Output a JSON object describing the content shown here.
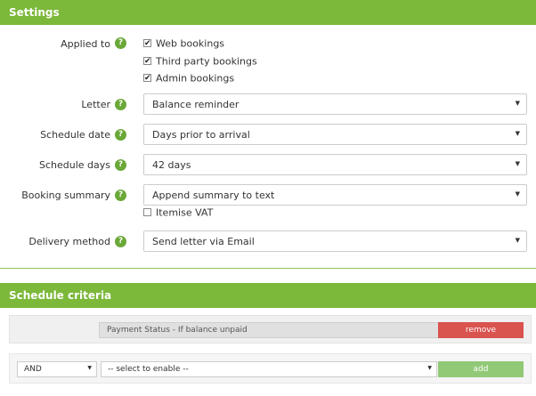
{
  "settings": {
    "title": "Settings",
    "applied_to": {
      "label": "Applied to",
      "options": [
        {
          "label": "Web bookings",
          "checked": true
        },
        {
          "label": "Third party bookings",
          "checked": true
        },
        {
          "label": "Admin bookings",
          "checked": true
        }
      ]
    },
    "letter": {
      "label": "Letter",
      "value": "Balance reminder"
    },
    "schedule_date": {
      "label": "Schedule date",
      "value": "Days prior to arrival"
    },
    "schedule_days": {
      "label": "Schedule days",
      "value": "42 days"
    },
    "booking_summary": {
      "label": "Booking summary",
      "value": "Append summary to text",
      "itemise_vat": {
        "label": "Itemise VAT",
        "checked": false
      }
    },
    "delivery_method": {
      "label": "Delivery method",
      "value": "Send letter via Email"
    }
  },
  "schedule_criteria": {
    "title": "Schedule criteria",
    "criteria": [
      {
        "text": "Payment Status - If balance unpaid",
        "remove_label": "remove"
      }
    ],
    "new_row": {
      "operator": "AND",
      "field_placeholder": "-- select to enable --",
      "add_label": "add"
    }
  },
  "icons": {
    "help": "help-question-icon",
    "check": "checkmark-icon",
    "dropdown": "dropdown-arrow-icon"
  },
  "colors": {
    "header_green": "#7cb83a",
    "help_green": "#6aa838",
    "remove_red": "#d9534f",
    "add_green": "#92c977"
  }
}
